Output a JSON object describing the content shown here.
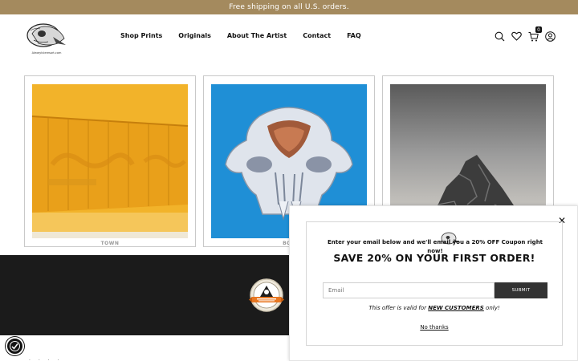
{
  "announcement": {
    "text": "Free shipping on all U.S. orders."
  },
  "logo": {
    "caption": "AlexeyIvleresort.com"
  },
  "nav": {
    "items": [
      "Shop Prints",
      "Originals",
      "About The Artist",
      "Contact",
      "FAQ"
    ]
  },
  "header_icons": {
    "search": "search-icon",
    "wishlist": "heart-icon",
    "cart": "cart-icon",
    "account": "user-icon",
    "cart_count": "0"
  },
  "products": [
    {
      "caption": "TOWN",
      "art": "freight-train-painting"
    },
    {
      "caption": "BOR",
      "art": "skull-painting"
    },
    {
      "caption": "",
      "art": "mountain-drawing"
    }
  ],
  "popup": {
    "title": "SAVE 20% ON YOUR FIRST ORDER!",
    "subtitle": "Enter your email below and we'll email you a 20% OFF Coupon right now!",
    "email_placeholder": "Email",
    "submit_label": "SUBMIT",
    "offer_prefix": "This offer is valid for ",
    "offer_highlight": "NEW CUSTOMERS",
    "offer_suffix": " only!",
    "dismiss_label": "No thanks",
    "close_glyph": "✕"
  },
  "bottom_strip": {
    "text": "·   ·   ·   ·"
  },
  "colors": {
    "announcement_bg": "#a48a5e",
    "dark_band": "#1b1b1b",
    "submit_bg": "#333333"
  }
}
